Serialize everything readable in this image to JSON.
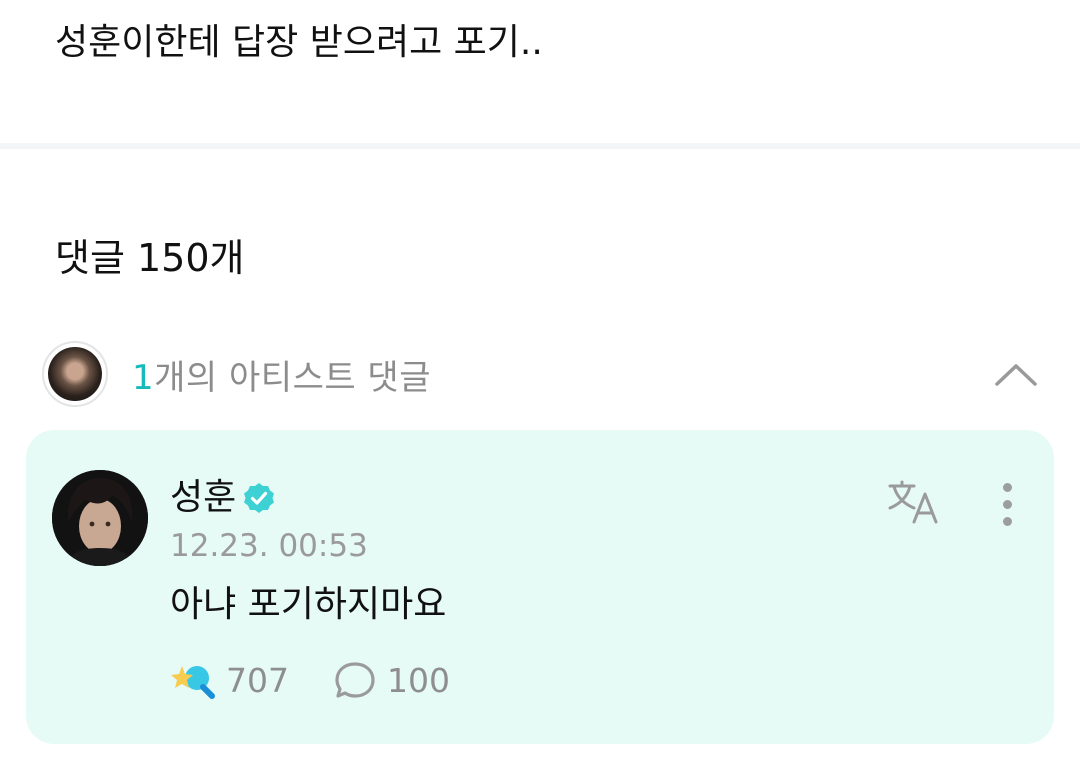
{
  "post": {
    "text": "성훈이한테 답장 받으려고 포기.."
  },
  "comments": {
    "count_label": "댓글 150개",
    "artist_section": {
      "count": "1",
      "label_suffix": "개의 아티스트 댓글",
      "collapse_icon": "chevron-up-icon"
    },
    "artist_comment": {
      "author": "성훈",
      "verified_icon": "verified-badge-icon",
      "timestamp": "12.23. 00:53",
      "body": "아냐 포기하지마요",
      "like_icon": "sparkle-like-icon",
      "like_count": "707",
      "reply_icon": "reply-bubble-icon",
      "reply_count": "100",
      "translate_icon": "translate-icon",
      "more_icon": "more-vertical-icon"
    }
  },
  "colors": {
    "accent": "#17b9bb",
    "card_background": "#e6fbf6",
    "verified": "#3ed1d3"
  }
}
